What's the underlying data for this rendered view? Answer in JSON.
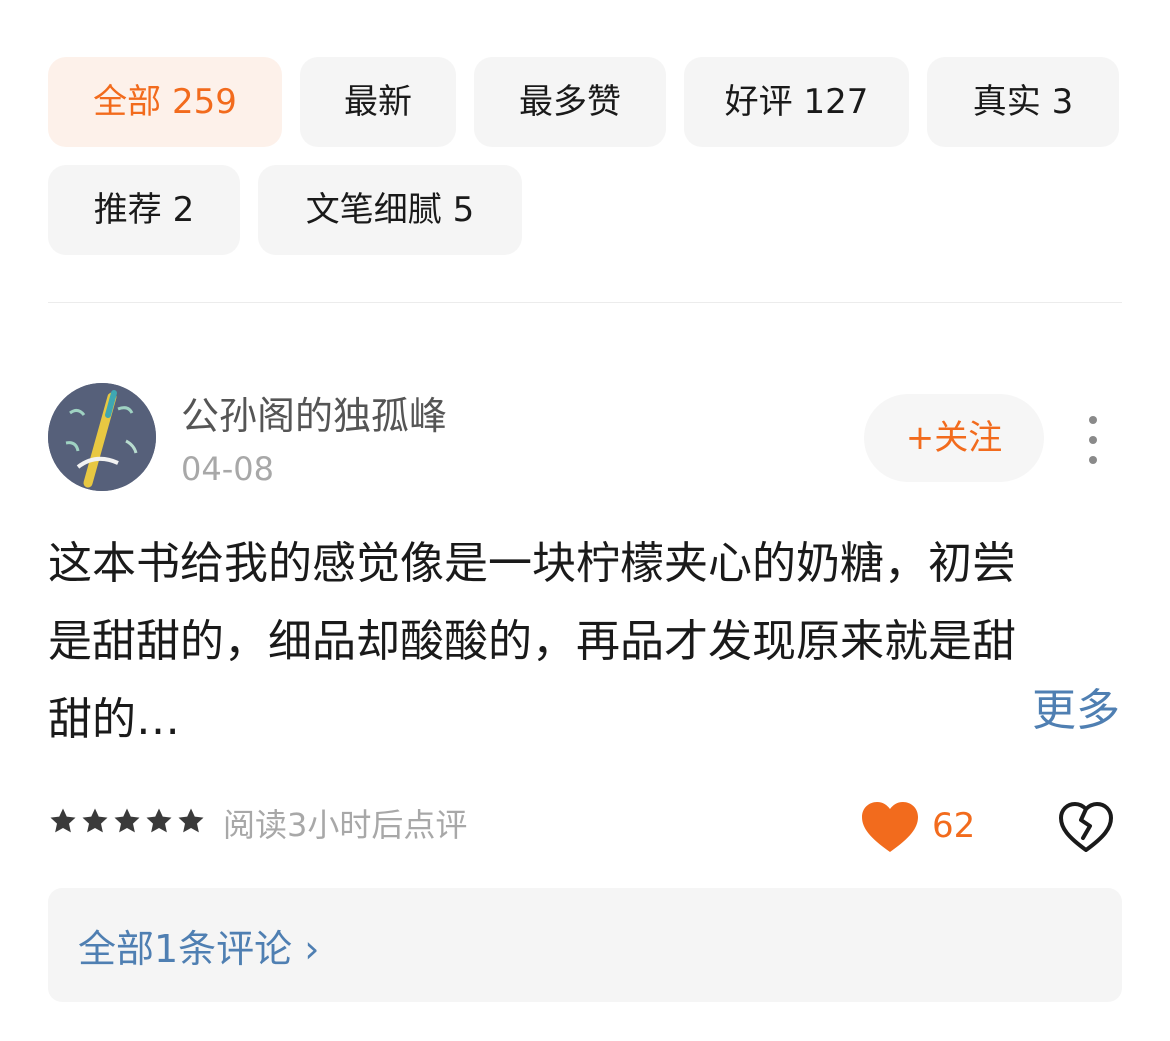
{
  "filters": [
    {
      "label": "全部 259",
      "active": true
    },
    {
      "label": "最新",
      "active": false
    },
    {
      "label": "最多赞",
      "active": false
    },
    {
      "label": "好评 127",
      "active": false
    },
    {
      "label": "真实 3",
      "active": false
    },
    {
      "label": "推荐 2",
      "active": false
    },
    {
      "label": "文笔细腻 5",
      "active": false
    }
  ],
  "review": {
    "username": "公孙阁的独孤峰",
    "date": "04-08",
    "follow_label": "+关注",
    "text_lines": [
      "这本书给我的感觉像是一块柠檬夹心的奶糖，初尝",
      "是甜甜的，细品却酸酸的，再品才发现原来就是甜",
      "甜的…"
    ],
    "more_label": "更多",
    "rating": 5,
    "read_note": "阅读3小时后点评",
    "like_count": "62",
    "comments_label": "全部1条评论 ›"
  },
  "colors": {
    "accent": "#f26b1d",
    "link": "#4f7fb2",
    "chip_bg": "#f5f5f5",
    "chip_active_bg": "#fdf1ea"
  }
}
